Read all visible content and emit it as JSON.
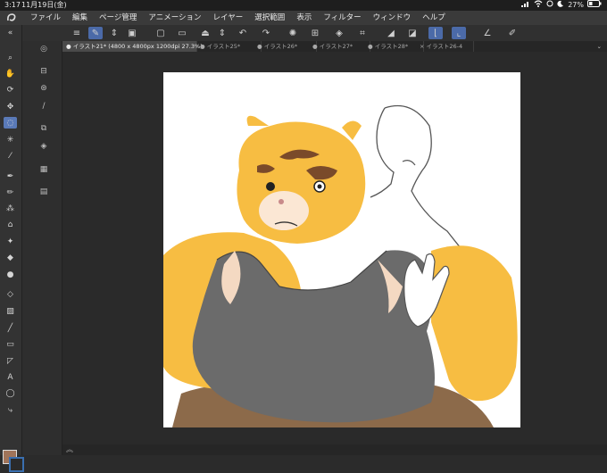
{
  "status_bar": {
    "time": "3:17",
    "date": "11月19日(金)",
    "battery": "27%",
    "icons": [
      "signal-icon",
      "wifi-icon",
      "location-icon",
      "moon-icon",
      "battery-icon"
    ]
  },
  "menu": {
    "logo_icon": "clip-studio-logo-icon",
    "items": [
      "ファイル",
      "編集",
      "ページ管理",
      "アニメーション",
      "レイヤー",
      "選択範囲",
      "表示",
      "フィルター",
      "ウィンドウ",
      "ヘルプ"
    ]
  },
  "toolbar": {
    "icons": [
      "hamburger-menu-icon",
      "selection-brush-icon",
      "up-down-arrows-icon",
      "layer-snapshot-icon",
      "new-file-icon",
      "open-folder-icon",
      "save-icon",
      "up-down-arrows-icon",
      "undo-icon",
      "redo-icon",
      "loading-spinner-icon",
      "transform-icon",
      "fill-icon",
      "crop-icon",
      "layer-ruler-icon",
      "layer-mask-icon",
      "ruler-snap-icon",
      "ruler-snap-alt-icon",
      "special-ruler-icon",
      "quick-access-icon"
    ]
  },
  "tabs": {
    "items": [
      {
        "label": "イラスト21* (4800 x 4800px 1200dpi 27.3%)",
        "active": true
      },
      {
        "label": "イラスト25*",
        "active": false
      },
      {
        "label": "イラスト26*",
        "active": false
      },
      {
        "label": "イラスト27*",
        "active": false
      },
      {
        "label": "イラスト28*",
        "active": false
      },
      {
        "label": "イラスト26-4",
        "active": false
      }
    ],
    "overflow_icon": "chevron-down-icon"
  },
  "tools": {
    "icons": [
      "expand-arrows-icon",
      "zoom-icon",
      "hand-icon",
      "rotate-icon",
      "move-icon",
      "lasso-select-icon",
      "magic-wand-icon",
      "eyedropper-icon",
      "pen-icon",
      "pencil-icon",
      "brush-icon",
      "airbrush-icon",
      "decoration-icon",
      "eraser-icon",
      "blend-icon",
      "fill-bucket-icon",
      "gradient-icon",
      "line-icon",
      "frame-icon",
      "ruler-icon",
      "text-icon",
      "balloon-icon",
      "correct-line-icon"
    ],
    "text_tool_glyph": "A",
    "active_tool": "lasso-select-icon"
  },
  "sub_tools": {
    "icons": [
      "navigator-icon",
      "layer-property-icon",
      "layer-search-icon",
      "brush-size-icon",
      "sub-tool-detail-icon",
      "layer-icon",
      "color-set-icon",
      "material-icon"
    ]
  },
  "colors": {
    "main": "#a0745a",
    "sub": "#3a6fb0",
    "accent": "#4b6aa8"
  },
  "bottom_bar": {
    "icon": "double-chevron-up-icon"
  }
}
